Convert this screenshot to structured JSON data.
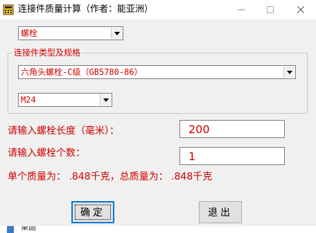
{
  "window": {
    "title": "连接件质量计算（作者：能亚洲）",
    "icons": {
      "app": "calculator-app-icon",
      "minimize": "minimize-icon",
      "maximize": "maximize-icon",
      "close": "close-icon"
    }
  },
  "part_type": {
    "selected": "螺栓"
  },
  "spec_group": {
    "label": "连接件类型及规格",
    "standard": {
      "selected": "六角头螺栓-C级（GB5780-86）"
    },
    "size": {
      "selected": "M24"
    }
  },
  "length": {
    "label": "请输入螺栓长度（毫米）：",
    "value": "200"
  },
  "count": {
    "label": "请输入螺栓个数：",
    "value": "1"
  },
  "result": {
    "text": "单个质量为： .848千克，总质量为： .848千克"
  },
  "buttons": {
    "ok": "确定",
    "exit": "退出"
  },
  "taskbar": {
    "text": "桌面"
  },
  "colors": {
    "label_red": "#d00000",
    "focus_blue": "#0078d7"
  }
}
